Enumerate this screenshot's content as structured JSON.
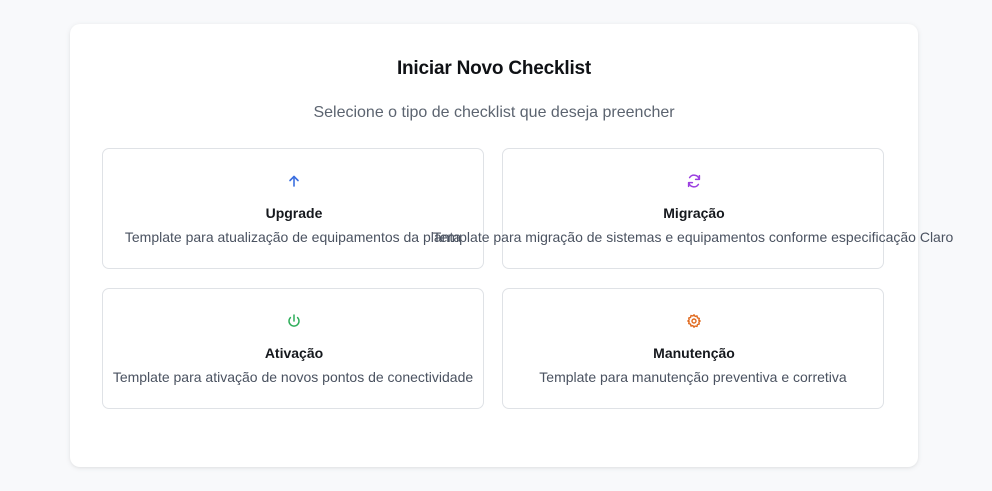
{
  "page": {
    "title": "Iniciar Novo Checklist",
    "subtitle": "Selecione o tipo de checklist que deseja preencher"
  },
  "options": [
    {
      "label": "Upgrade",
      "description": "Template para atualização de equipamentos da planta",
      "icon": "arrow-up-icon",
      "color": "#3b6fe0"
    },
    {
      "label": "Migração",
      "description": "Template para migração de sistemas e equipamentos conforme especificação Claro",
      "icon": "refresh-icon",
      "color": "#9b3fe0"
    },
    {
      "label": "Ativação",
      "description": "Template para ativação de novos pontos de conectividade",
      "icon": "power-icon",
      "color": "#2fae5b"
    },
    {
      "label": "Manutenção",
      "description": "Template para manutenção preventiva e corretiva",
      "icon": "gear-icon",
      "color": "#e06a1f"
    }
  ]
}
